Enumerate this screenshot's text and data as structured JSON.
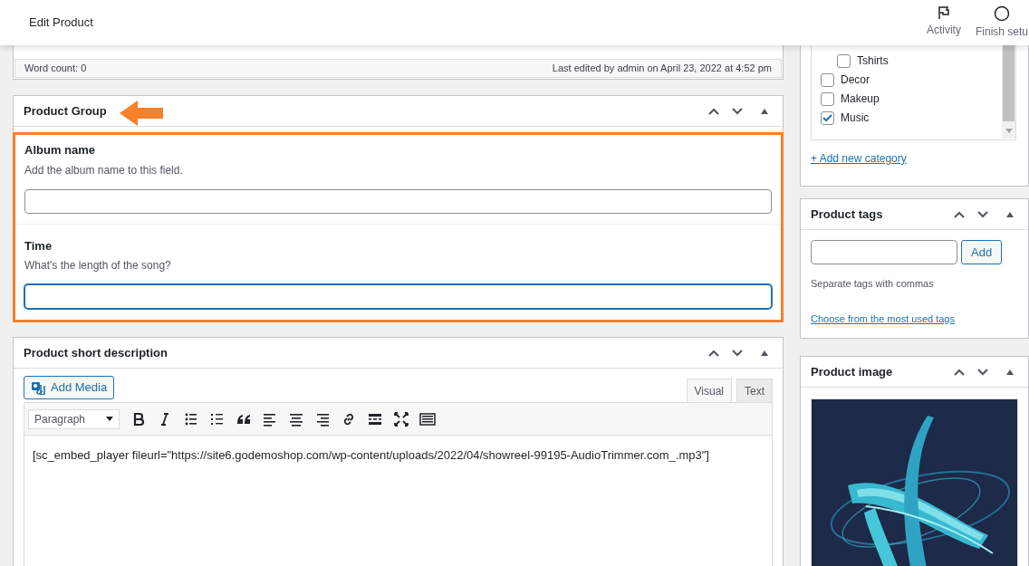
{
  "header": {
    "title": "Edit Product",
    "actions": [
      {
        "kind": "flag",
        "label": "Activity"
      },
      {
        "kind": "circle",
        "label": "Finish setu"
      }
    ]
  },
  "editor_footer": {
    "word_count": "Word count: 0",
    "last_edited": "Last edited by admin on April 23, 2022 at 4:52 pm"
  },
  "product_group": {
    "title": "Product Group",
    "fields": [
      {
        "label": "Album name",
        "description": "Add the album name to this field.",
        "focused": false
      },
      {
        "label": "Time",
        "description": "What's the length of the song?",
        "focused": true
      }
    ]
  },
  "short_description": {
    "title": "Product short description",
    "add_media": "Add Media",
    "tabs": [
      {
        "label": "Visual",
        "selected": true
      },
      {
        "label": "Text",
        "selected": false
      }
    ],
    "format_select": "Paragraph",
    "content": "[sc_embed_player fileurl=\"https://site6.godemoshop.com/wp-content/uploads/2022/04/showreel-99195-AudioTrimmer.com_.mp3\"]"
  },
  "categories": {
    "items": [
      {
        "kind": "subcategory",
        "label": "Tshirts",
        "checked": false
      },
      {
        "kind": "category",
        "label": "Decor",
        "checked": false
      },
      {
        "kind": "category",
        "label": "Makeup",
        "checked": false
      },
      {
        "kind": "category",
        "label": "Music",
        "checked": true
      }
    ],
    "add_link": "+ Add new category"
  },
  "product_tags": {
    "title": "Product tags",
    "add_button": "Add",
    "hint": "Separate tags with commas",
    "link": "Choose from the most used tags"
  },
  "product_image": {
    "title": "Product image"
  }
}
